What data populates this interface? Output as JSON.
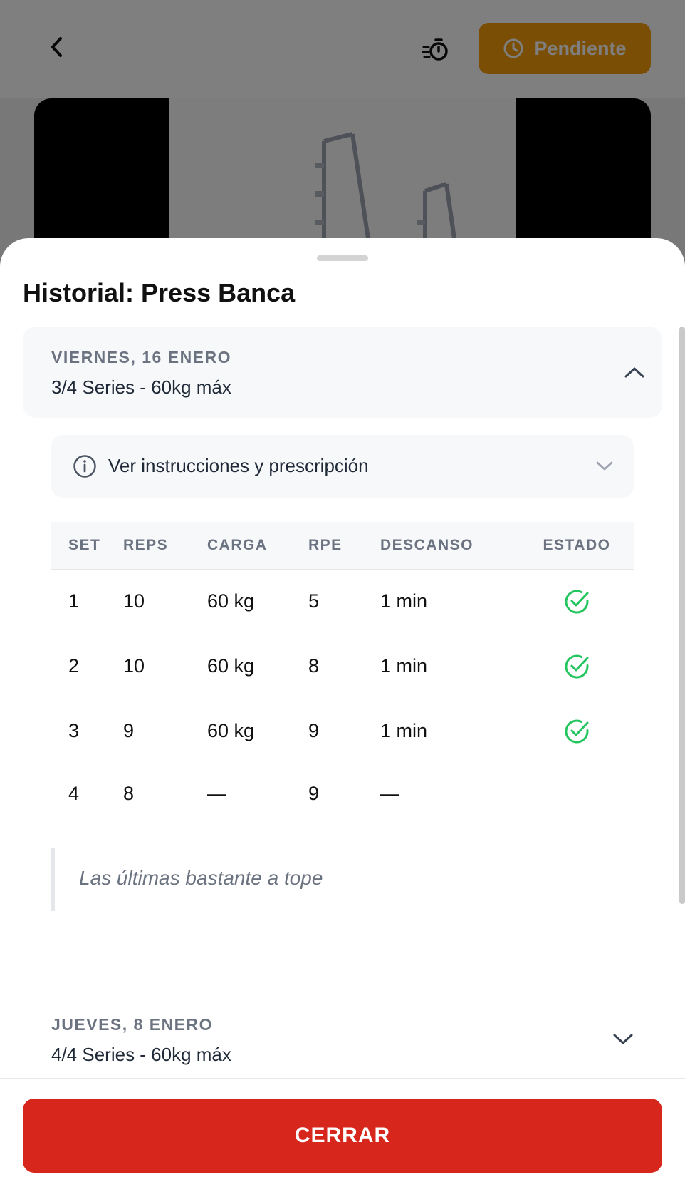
{
  "topbar": {
    "status_label": "Pendiente",
    "icons": [
      "chevron-left-icon",
      "stopwatch-icon",
      "clock-icon"
    ],
    "status_color": "#f59e0b"
  },
  "sheet": {
    "title": "Historial: Press Banca",
    "sessions": [
      {
        "date": "VIERNES, 16 ENERO",
        "summary": "3/4 Series - 60kg máx",
        "expanded": true,
        "instructions_label": "Ver instrucciones y prescripción",
        "table": {
          "headers": [
            "SET",
            "REPS",
            "CARGA",
            "RPE",
            "DESCANSO",
            "ESTADO"
          ],
          "rows": [
            {
              "set": "1",
              "reps": "10",
              "carga": "60 kg",
              "rpe": "5",
              "descanso": "1 min",
              "completed": true
            },
            {
              "set": "2",
              "reps": "10",
              "carga": "60 kg",
              "rpe": "8",
              "descanso": "1 min",
              "completed": true
            },
            {
              "set": "3",
              "reps": "9",
              "carga": "60 kg",
              "rpe": "9",
              "descanso": "1 min",
              "completed": true
            },
            {
              "set": "4",
              "reps": "8",
              "carga": "—",
              "rpe": "9",
              "descanso": "—",
              "completed": false
            }
          ]
        },
        "note": "Las últimas bastante a tope"
      },
      {
        "date": "JUEVES, 8 ENERO",
        "summary": "4/4 Series - 60kg máx",
        "expanded": false
      }
    ],
    "close_label": "CERRAR"
  },
  "colors": {
    "accent_red": "#d7261b",
    "check_green": "#22c55e",
    "pending_orange": "#f59e0b"
  }
}
